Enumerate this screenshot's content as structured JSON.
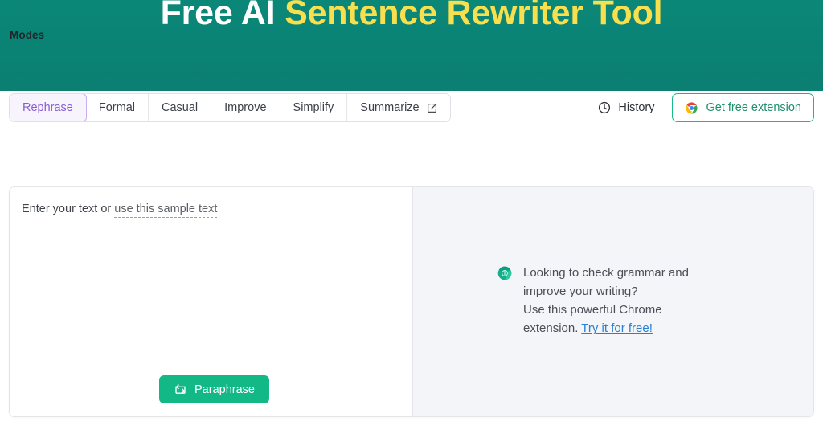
{
  "header": {
    "title_part_white": "Free AI ",
    "title_part_yellow": "Sentence Rewriter Tool",
    "background_color": "#0a8274",
    "title_white_color": "#ffffff",
    "title_yellow_color": "#f7df4e"
  },
  "modes": {
    "label": "Modes",
    "active_index": 0,
    "active_color": "#8b5cd6",
    "tabs": [
      {
        "label": "Rephrase",
        "active": true,
        "icon": null
      },
      {
        "label": "Formal",
        "active": false,
        "icon": null
      },
      {
        "label": "Casual",
        "active": false,
        "icon": null
      },
      {
        "label": "Improve",
        "active": false,
        "icon": null
      },
      {
        "label": "Simplify",
        "active": false,
        "icon": null
      },
      {
        "label": "Summarize",
        "active": false,
        "icon": "external-link-icon"
      }
    ]
  },
  "toolbar": {
    "history_label": "History",
    "history_icon": "clock-icon",
    "extension_label": "Get free extension",
    "extension_icon": "chrome-icon",
    "extension_border_color": "#19b98a",
    "extension_text_color": "#1f8f6d"
  },
  "editor": {
    "prompt_prefix": "Enter your text or ",
    "sample_link_label": "use this sample text",
    "input_value": "",
    "paraphrase_label": "Paraphrase",
    "paraphrase_icon": "repeat-icon",
    "paraphrase_color": "#12b886"
  },
  "promo": {
    "icon": "chrome-green-icon",
    "line1": "Looking to check grammar and",
    "line2": "improve your writing?",
    "line3": "Use this powerful Chrome",
    "line4_prefix": "extension. ",
    "link_label": "Try it for free!",
    "link_color": "#2a7fd4",
    "panel_background": "#f3f5f8"
  }
}
